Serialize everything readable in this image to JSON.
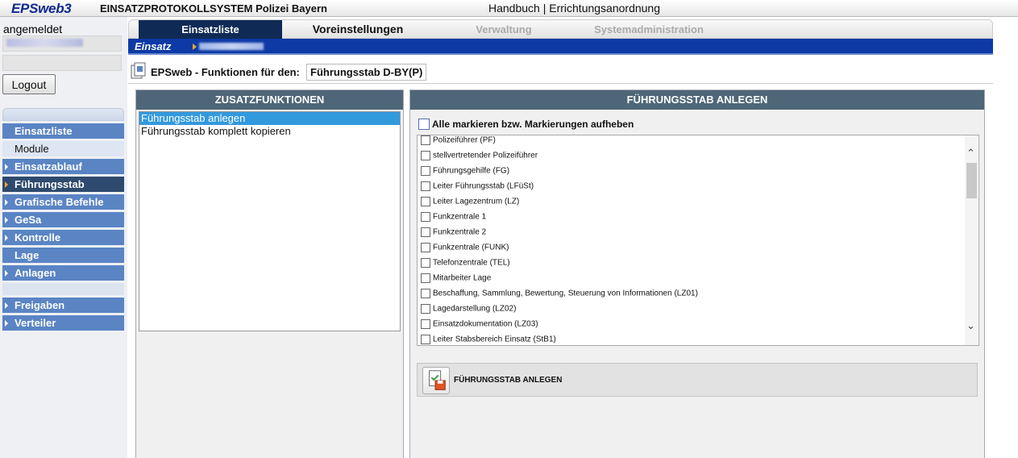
{
  "header": {
    "logo": "EPSweb3",
    "title": "EINSATZPROTOKOLLSYSTEM Polizei Bayern",
    "links": "Handbuch | Errichtungsanordnung"
  },
  "sidebar": {
    "user_label": "angemeldet",
    "logout_label": "Logout",
    "nav": [
      {
        "label": "Einsatzliste",
        "kind": "item"
      },
      {
        "label": "Module",
        "kind": "plain"
      },
      {
        "label": "Einsatzablauf",
        "kind": "arrow"
      },
      {
        "label": "Führungsstab",
        "kind": "active"
      },
      {
        "label": "Grafische Befehle",
        "kind": "arrow"
      },
      {
        "label": "GeSa",
        "kind": "arrow"
      },
      {
        "label": "Kontrolle",
        "kind": "arrow"
      },
      {
        "label": "Lage",
        "kind": "item"
      },
      {
        "label": "Anlagen",
        "kind": "arrow"
      },
      {
        "label": "Freigaben",
        "kind": "arrow"
      },
      {
        "label": "Verteiler",
        "kind": "arrow"
      }
    ]
  },
  "tabs": {
    "einsatzliste": "Einsatzliste",
    "voreinstellungen": "Voreinstellungen",
    "verwaltung": "Verwaltung",
    "systemadministration": "Systemadministration"
  },
  "breadcrumb": {
    "root": "Einsatz"
  },
  "function_row": {
    "label": "EPSweb - Funktionen für den:",
    "value": "Führungsstab D-BY(P)"
  },
  "zusatz": {
    "header": "ZUSATZFUNKTIONEN",
    "items": [
      {
        "label": "Führungsstab anlegen",
        "selected": true
      },
      {
        "label": "Führungsstab komplett kopieren",
        "selected": false
      }
    ]
  },
  "anlegen": {
    "header": "FÜHRUNGSSTAB ANLEGEN",
    "mark_all": "Alle markieren bzw. Markierungen aufheben",
    "items": [
      "Polizeiführer (PF)",
      "stellvertretender Polizeiführer",
      "Führungsgehilfe (FG)",
      "Leiter Führungsstab (LFüSt)",
      "Leiter Lagezentrum (LZ)",
      "Funkzentrale 1",
      "Funkzentrale 2",
      "Funkzentrale (FUNK)",
      "Telefonzentrale (TEL)",
      "Mitarbeiter Lage",
      "Beschaffung, Sammlung, Bewertung, Steuerung von Informationen (LZ01)",
      "Lagedarstellung (LZ02)",
      "Einsatzdokumentation (LZ03)",
      "Leiter Stabsbereich Einsatz (StB1)"
    ],
    "button_label": "FÜHRUNGSSTAB ANLEGEN"
  },
  "colors": {
    "nav_blue": "#5a84c4",
    "nav_active": "#2e4a6e",
    "header_blue": "#0d3aa5",
    "column_header": "#4e6677",
    "selection": "#3399dd"
  }
}
